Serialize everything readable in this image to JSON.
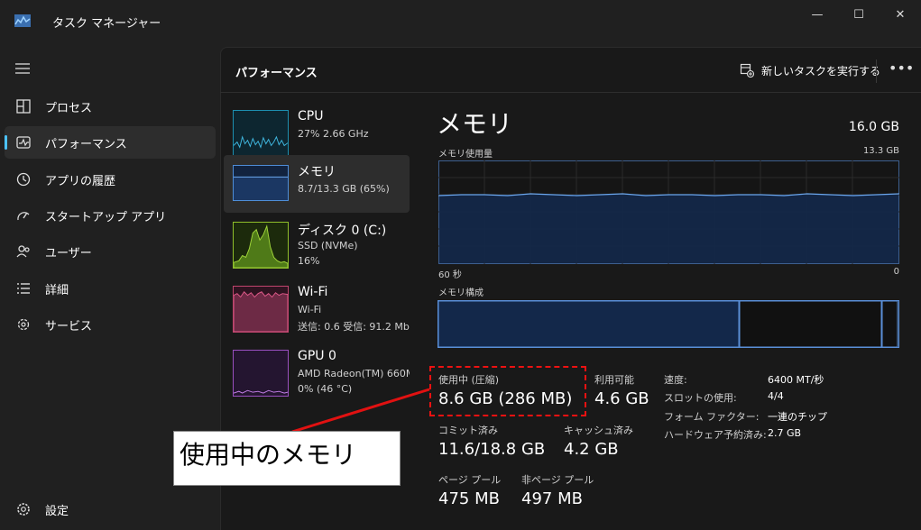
{
  "window": {
    "title": "タスク マネージャー",
    "minimize_glyph": "—",
    "maximize_glyph": "☐",
    "close_glyph": "✕"
  },
  "sidebar": {
    "menu_icon": "hamburger-icon",
    "items": [
      {
        "label": "プロセス",
        "icon": "processes-icon"
      },
      {
        "label": "パフォーマンス",
        "icon": "performance-icon",
        "active": true
      },
      {
        "label": "アプリの履歴",
        "icon": "history-icon"
      },
      {
        "label": "スタートアップ アプリ",
        "icon": "startup-icon"
      },
      {
        "label": "ユーザー",
        "icon": "users-icon"
      },
      {
        "label": "詳細",
        "icon": "details-icon"
      },
      {
        "label": "サービス",
        "icon": "services-icon"
      }
    ],
    "settings_label": "設定"
  },
  "header": {
    "title": "パフォーマンス",
    "new_task_label": "新しいタスクを実行する",
    "more_glyph": "•••"
  },
  "resources": [
    {
      "name": "CPU",
      "line1": "27%  2.66 GHz",
      "line2": "",
      "color": "#1d8fb0"
    },
    {
      "name": "メモリ",
      "line1": "8.7/13.3 GB (65%)",
      "line2": "",
      "color": "#4e8dd8"
    },
    {
      "name": "ディスク 0 (C:)",
      "line1": "SSD (NVMe)",
      "line2": "16%",
      "color": "#8fbf2a"
    },
    {
      "name": "Wi-Fi",
      "line1": "Wi-Fi",
      "line2": "送信: 0.6  受信: 91.2 Mb",
      "color": "#c0456d"
    },
    {
      "name": "GPU 0",
      "line1": "AMD Radeon(TM) 660M",
      "line2": "0%  (46 °C)",
      "color": "#9a50c0"
    }
  ],
  "detail": {
    "title": "メモリ",
    "total": "16.0 GB",
    "usage_label": "メモリ使用量",
    "usage_max": "13.3 GB",
    "x_left": "60 秒",
    "x_right": "0",
    "composition_label": "メモリ構成",
    "usage_fraction": 0.67,
    "composition_segments": [
      0.655,
      0.31,
      0.035
    ],
    "stats": {
      "in_use_label": "使用中 (圧縮)",
      "in_use_value": "8.6 GB (286 MB)",
      "available_label": "利用可能",
      "available_value": "4.6 GB",
      "committed_label": "コミット済み",
      "committed_value": "11.6/18.8 GB",
      "cached_label": "キャッシュ済み",
      "cached_value": "4.2 GB",
      "paged_label": "ページ プール",
      "paged_value": "475 MB",
      "nonpaged_label": "非ページ プール",
      "nonpaged_value": "497 MB"
    },
    "specs": [
      {
        "k": "速度:",
        "v": "6400 MT/秒"
      },
      {
        "k": "スロットの使用:",
        "v": "4/4"
      },
      {
        "k": "フォーム ファクター:",
        "v": "一連のチップ"
      },
      {
        "k": "ハードウェア予約済み:",
        "v": "2.7 GB"
      }
    ]
  },
  "annotation": {
    "text": "使用中のメモリ",
    "color": "#e11111"
  }
}
